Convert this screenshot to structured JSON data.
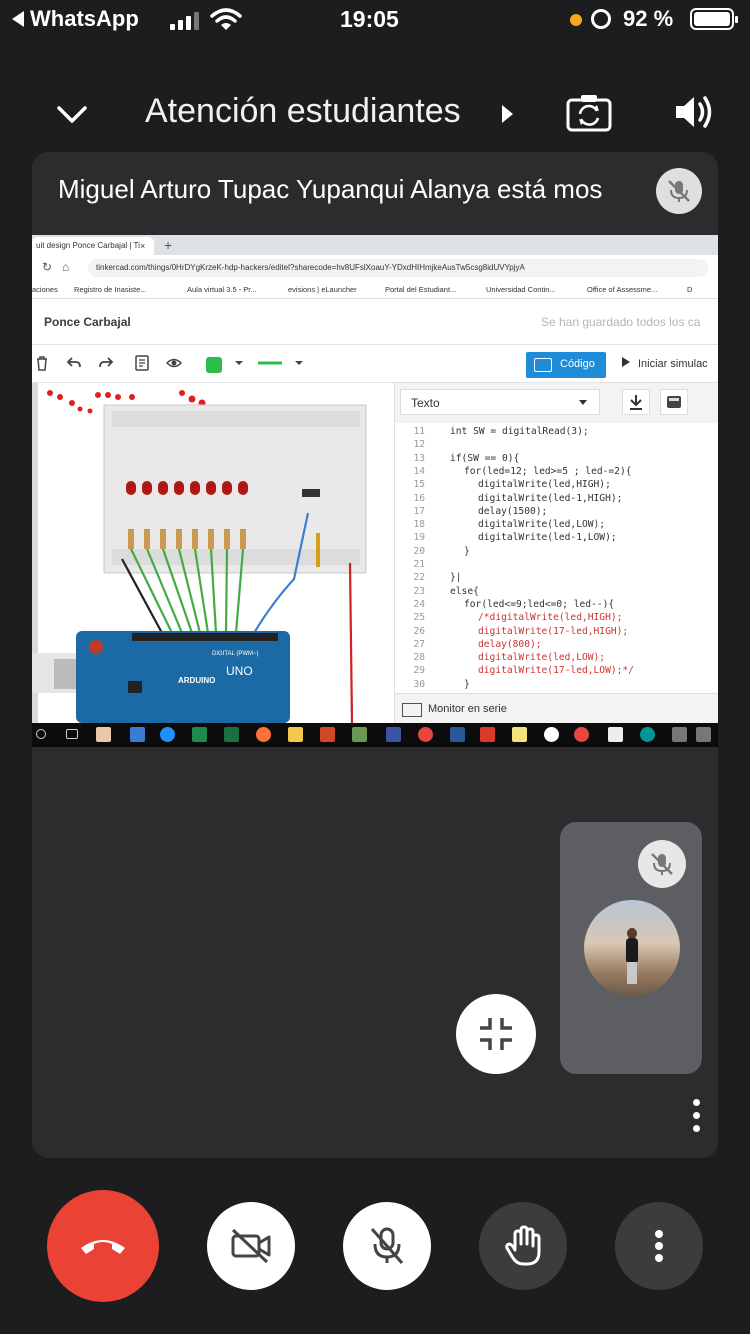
{
  "status_bar": {
    "back_app": "WhatsApp",
    "time": "19:05",
    "battery_percent": "92 %",
    "battery_level": 0.92,
    "colors": {
      "recording_dot": "#f5a623"
    }
  },
  "top_bar": {
    "title": "Atención estudiantes"
  },
  "presentation": {
    "presenter_text": "Miguel Arturo Tupac Yupanqui Alanya está mos",
    "shared_screen": {
      "tab_title": "uit design Ponce Carbajal | Ti",
      "tab_close": "×",
      "new_tab": "+",
      "url": "tinkercad.com/things/0HrDYgKrzeK-hdp-hackers/editel?sharecode=hv8UFslXoauY-YDxdHIHmjkeAusTw5csg8idUVYpjyA",
      "bookmarks": [
        "aciones",
        "Registro de Inasiste...",
        "Aula virtual 3.5 - Pr...",
        "evisions | eLauncher",
        "Portal del Estudiant...",
        "Universidad Contin...",
        "Office of Assessme...",
        "D"
      ],
      "project_title": "Ponce Carbajal",
      "saved_status": "Se han guardado todos los ca",
      "code_button": "Código",
      "simulate_button": "Iniciar simulac",
      "code_mode": "Texto",
      "serial_monitor": "Monitor en serie",
      "code_lines": [
        {
          "n": "11",
          "t": "int SW = digitalRead(3);",
          "indent": 0
        },
        {
          "n": "12",
          "t": "",
          "indent": 0
        },
        {
          "n": "13",
          "t": "if(SW == 0){",
          "indent": 0
        },
        {
          "n": "14",
          "t": "for(led=12; led>=5 ; led-=2){",
          "indent": 1
        },
        {
          "n": "15",
          "t": "digitalWrite(led,HIGH);",
          "indent": 2
        },
        {
          "n": "16",
          "t": "digitalWrite(led-1,HIGH);",
          "indent": 2
        },
        {
          "n": "17",
          "t": "delay(1500);",
          "indent": 2
        },
        {
          "n": "18",
          "t": "digitalWrite(led,LOW);",
          "indent": 2
        },
        {
          "n": "19",
          "t": "digitalWrite(led-1,LOW);",
          "indent": 2
        },
        {
          "n": "20",
          "t": "}",
          "indent": 1
        },
        {
          "n": "21",
          "t": "",
          "indent": 0
        },
        {
          "n": "22",
          "t": "}|",
          "indent": 0
        },
        {
          "n": "23",
          "t": "else{",
          "indent": 0
        },
        {
          "n": "24",
          "t": "for(led<=9;led<=0; led--){",
          "indent": 1
        },
        {
          "n": "25",
          "t": "/*digitalWrite(led,HIGH);",
          "indent": 2
        },
        {
          "n": "26",
          "t": "digitalWrite(17-led,HIGH);",
          "indent": 2
        },
        {
          "n": "27",
          "t": "delay(800);",
          "indent": 2
        },
        {
          "n": "28",
          "t": "digitalWrite(led,LOW);",
          "indent": 2
        },
        {
          "n": "29",
          "t": "digitalWrite(17-led,LOW);*/",
          "indent": 2
        },
        {
          "n": "30",
          "t": "}",
          "indent": 1
        }
      ],
      "arduino_labels": {
        "brand": "ARDUINO",
        "model": "UNO",
        "digital": "DIGITAL (PWM~)"
      }
    }
  },
  "self_view": {
    "muted": true
  },
  "controls": {
    "colors": {
      "hangup": "#ea4335",
      "light_button": "#ffffff",
      "dark_button": "#3c3c3e"
    }
  }
}
